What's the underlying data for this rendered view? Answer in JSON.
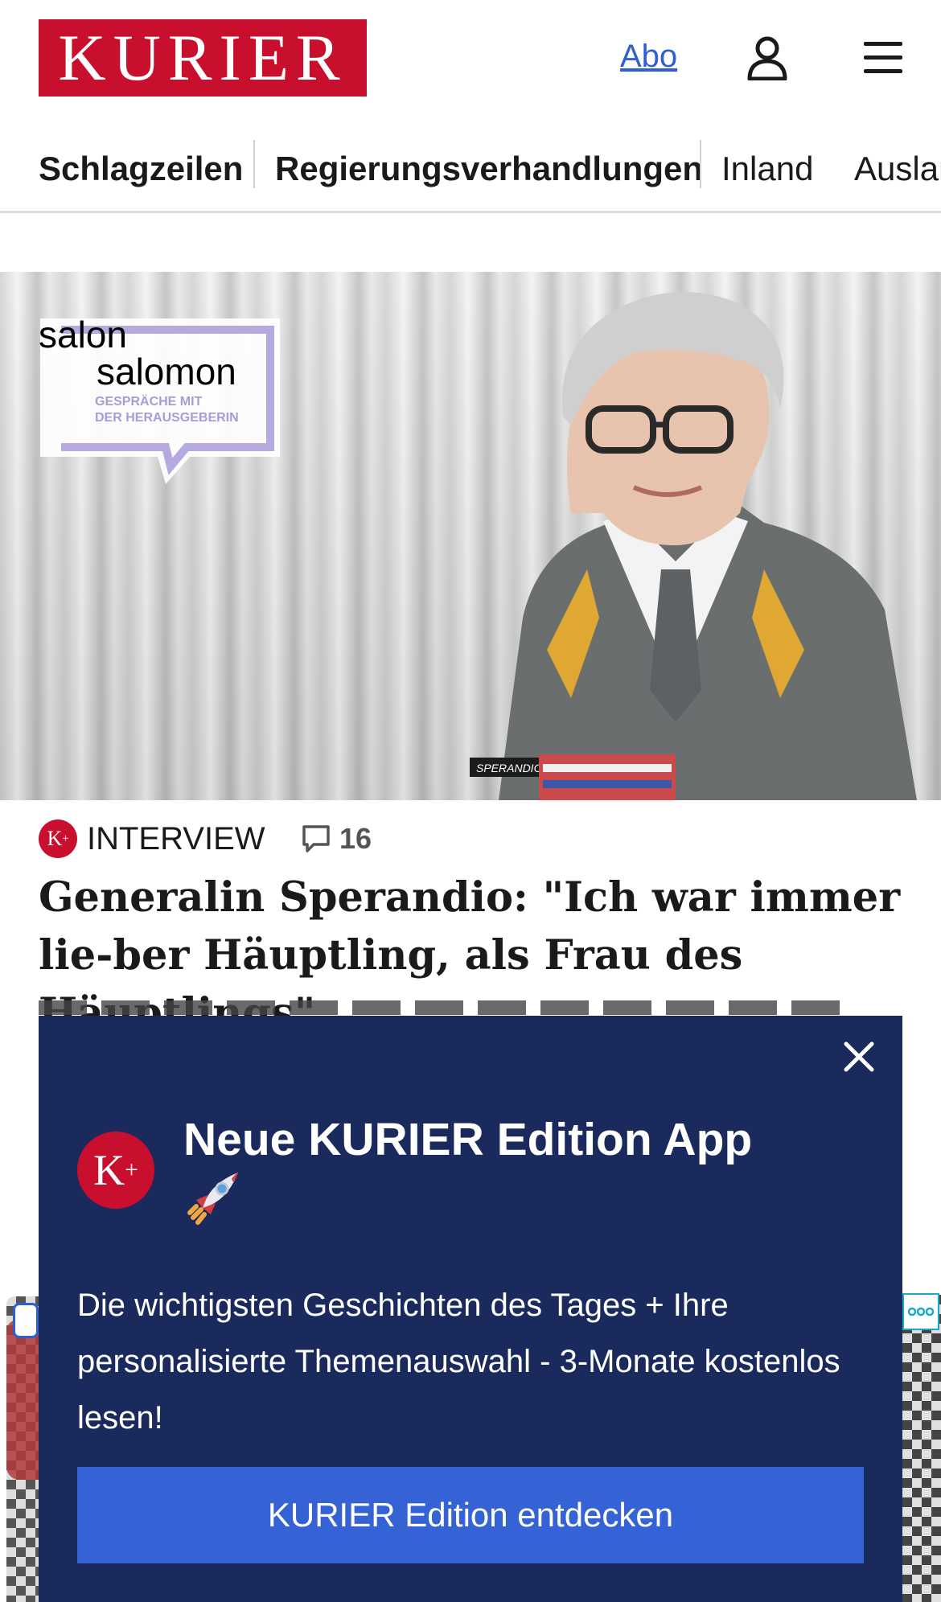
{
  "header": {
    "logo_text": "KURIER",
    "abo_label": "Abo",
    "user_icon": "user-icon",
    "menu_icon": "hamburger-menu-icon"
  },
  "nav": {
    "items": [
      {
        "label": "Schlagzeilen"
      },
      {
        "label": "Regierungsverhandlungen"
      },
      {
        "label": "Inland"
      },
      {
        "label": "Ausland"
      }
    ]
  },
  "hero": {
    "logo_line1": "salon",
    "logo_line2": "salomon",
    "logo_sub1": "GESPRÄCHE MIT",
    "logo_sub2": "DER HERAUSGEBERIN",
    "name_tag": "SPERANDIO"
  },
  "article": {
    "badge": "K",
    "badge_sup": "+",
    "tag": "INTERVIEW",
    "comment_count": "16",
    "headline": "Generalin Sperandio: \"Ich war immer lie-ber Häuptling, als Frau des Häuptlings\""
  },
  "modal": {
    "badge": "K",
    "badge_sup": "+",
    "title": "Neue KURIER Edition App",
    "title_icon": "rocket-icon",
    "text": "Die wichtigsten Geschichten des Tages + Ihre personalisierte Themenauswahl - 3-Monate kostenlos lesen!",
    "cta_label": "KURIER Edition entdecken",
    "close_icon": "close-icon"
  },
  "colors": {
    "brand_red": "#c8102e",
    "modal_bg": "#1b2a5c",
    "cta_blue": "#3563d6",
    "link_blue": "#2f5fd0"
  }
}
